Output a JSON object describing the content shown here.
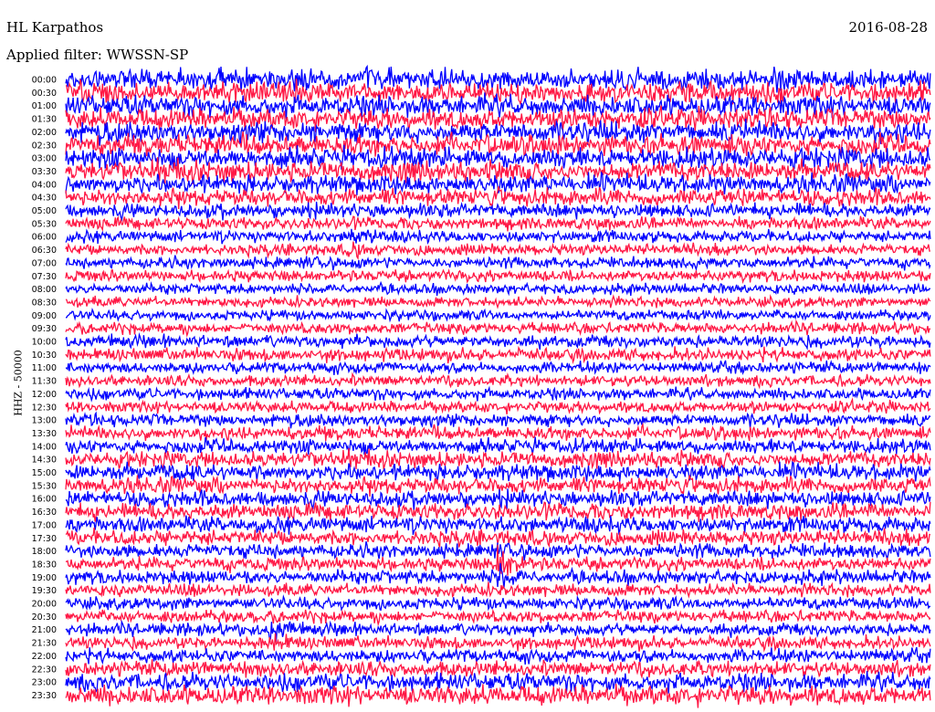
{
  "header": {
    "station": "HL Karpathos",
    "date": "2016-08-28",
    "filter": "Applied filter: WWSSN-SP",
    "axis_label": "HHZ - 50000"
  },
  "chart_data": {
    "type": "line",
    "title": "HL Karpathos",
    "subtitle": "Applied filter: WWSSN-SP",
    "ylabel": "HHZ - 50000",
    "row_labels": [
      "00:00",
      "00:30",
      "01:00",
      "01:30",
      "02:00",
      "02:30",
      "03:00",
      "03:30",
      "04:00",
      "04:30",
      "05:00",
      "05:30",
      "06:00",
      "06:30",
      "07:00",
      "07:30",
      "08:00",
      "08:30",
      "09:00",
      "09:30",
      "10:00",
      "10:30",
      "11:00",
      "11:30",
      "12:00",
      "12:30",
      "13:00",
      "13:30",
      "14:00",
      "14:30",
      "15:00",
      "15:30",
      "16:00",
      "16:30",
      "17:00",
      "17:30",
      "18:00",
      "18:30",
      "19:00",
      "19:30",
      "20:00",
      "20:30",
      "21:00",
      "21:30",
      "22:00",
      "22:30",
      "23:00",
      "23:30"
    ],
    "colors": [
      "#0000ff",
      "#ff1744"
    ],
    "noise_level_per_row": [
      1.0,
      1.0,
      1.0,
      1.0,
      1.0,
      1.0,
      1.0,
      0.95,
      0.9,
      0.85,
      0.7,
      0.6,
      0.55,
      0.55,
      0.55,
      0.55,
      0.5,
      0.5,
      0.5,
      0.55,
      0.6,
      0.6,
      0.55,
      0.55,
      0.55,
      0.55,
      0.6,
      0.65,
      0.7,
      0.75,
      0.8,
      0.8,
      0.8,
      0.8,
      0.75,
      0.75,
      0.7,
      0.65,
      0.65,
      0.6,
      0.6,
      0.6,
      0.6,
      0.6,
      0.65,
      0.75,
      0.85,
      0.95
    ],
    "events": [
      {
        "row": 12,
        "time_frac": 0.33,
        "amp": 1.6
      },
      {
        "row": 37,
        "time_frac": 0.5,
        "amp": 2.6
      },
      {
        "row": 42,
        "time_frac": 0.24,
        "amp": 1.8
      }
    ],
    "grid": false
  }
}
